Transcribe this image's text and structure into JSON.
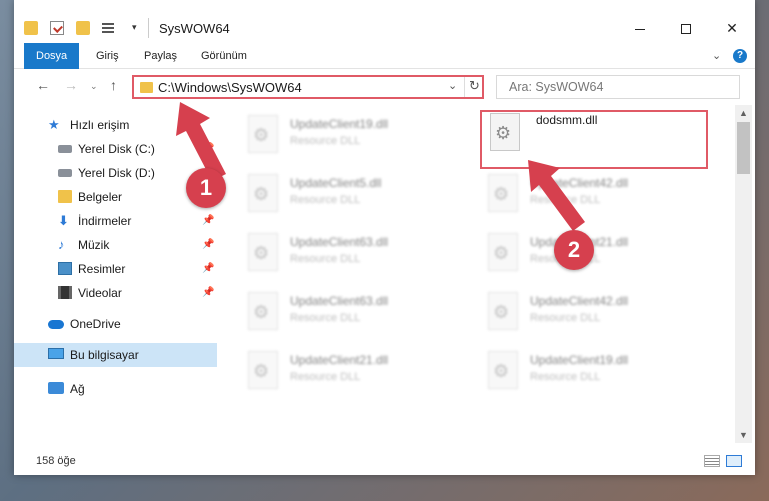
{
  "window": {
    "title": "SysWOW64",
    "controls": {
      "minimize": "",
      "maximize": "",
      "close": "✕"
    }
  },
  "toolbar": {
    "dropdown": "▾"
  },
  "ribbon": {
    "tabs": [
      {
        "label": "Dosya",
        "active": true
      },
      {
        "label": "Giriş"
      },
      {
        "label": "Paylaş"
      },
      {
        "label": "Görünüm"
      }
    ],
    "help": "?",
    "collapse": "⌄"
  },
  "navbar": {
    "back": "←",
    "forward": "→",
    "recent": "⌄",
    "up": "↑",
    "address": "C:\\Windows\\SysWOW64",
    "address_dropdown": "⌄",
    "refresh": "↻",
    "search_placeholder": "Ara: SysWOW64"
  },
  "sidebar": {
    "items": [
      {
        "label": "Hızlı erişim",
        "icon": "star-icon"
      },
      {
        "label": "Yerel Disk (C:)",
        "icon": "drive-icon",
        "pinned": true
      },
      {
        "label": "Yerel Disk (D:)",
        "icon": "drive-icon"
      },
      {
        "label": "Belgeler",
        "icon": "folder-icon"
      },
      {
        "label": "İndirmeler",
        "icon": "download-icon",
        "pinned": true
      },
      {
        "label": "Müzik",
        "icon": "music-icon",
        "pinned": true
      },
      {
        "label": "Resimler",
        "icon": "pictures-icon",
        "pinned": true
      },
      {
        "label": "Videolar",
        "icon": "videos-icon",
        "pinned": true
      },
      {
        "label": "OneDrive",
        "icon": "cloud-icon"
      },
      {
        "label": "Bu bilgisayar",
        "icon": "computer-icon",
        "selected": true
      },
      {
        "label": "Ağ",
        "icon": "network-icon"
      }
    ]
  },
  "files": [
    {
      "name": "UpdateClient19.dll",
      "type": "Resource DLL"
    },
    {
      "name": "dodsmm.dll",
      "type": ""
    },
    {
      "name": "UpdateClient5.dll",
      "type": "Resource DLL"
    },
    {
      "name": "UpdateClient42.dll",
      "type": "Resource DLL"
    },
    {
      "name": "UpdateClient63.dll",
      "type": "Resource DLL"
    },
    {
      "name": "UpdateClient21.dll",
      "type": "Resource DLL"
    },
    {
      "name": "UpdateClient63.dll",
      "type": "Resource DLL"
    },
    {
      "name": "UpdateClient42.dll",
      "type": "Resource DLL"
    },
    {
      "name": "UpdateClient21.dll",
      "type": "Resource DLL"
    },
    {
      "name": "UpdateClient19.dll",
      "type": "Resource DLL"
    }
  ],
  "statusbar": {
    "count": "158 öğe"
  },
  "annotations": {
    "step1": "1",
    "step2": "2",
    "accent": "#d6404e"
  }
}
